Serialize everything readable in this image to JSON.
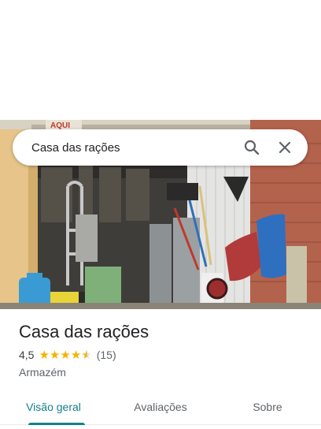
{
  "search": {
    "query": "Casa das rações",
    "search_icon": "search-icon",
    "close_icon": "close-icon"
  },
  "photo": {
    "sign_text": "AQUI"
  },
  "place": {
    "name": "Casa das rações",
    "rating": "4,5",
    "stars": 4.5,
    "review_count": "(15)",
    "category": "Armazém"
  },
  "tabs": [
    {
      "label": "Visão geral",
      "active": true
    },
    {
      "label": "Avaliações",
      "active": false
    },
    {
      "label": "Sobre",
      "active": false
    }
  ],
  "colors": {
    "accent": "#13808c",
    "star": "#f4b400"
  }
}
